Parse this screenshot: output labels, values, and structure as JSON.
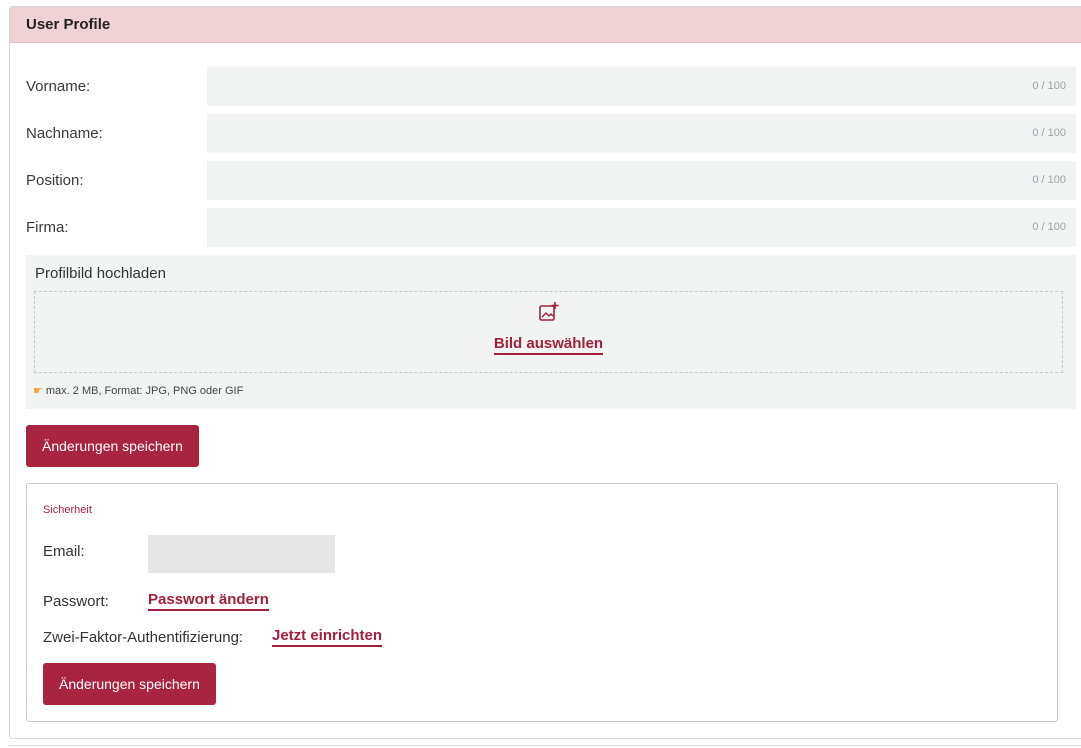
{
  "panel": {
    "title": "User Profile"
  },
  "fields": [
    {
      "label": "Vorname:",
      "value": "",
      "counter": "0 / 100"
    },
    {
      "label": "Nachname:",
      "value": "",
      "counter": "0 / 100"
    },
    {
      "label": "Position:",
      "value": "",
      "counter": "0 / 100"
    },
    {
      "label": "Firma:",
      "value": "",
      "counter": "0 / 100"
    }
  ],
  "upload": {
    "title": "Profilbild hochladen",
    "link_label": "Bild auswählen",
    "hint": "max. 2 MB, Format: JPG, PNG oder GIF",
    "icon": "add-image-icon",
    "hint_icon": "pointing-hand-icon"
  },
  "save_button_label": "Änderungen speichern",
  "security": {
    "title": "Sicherheit",
    "email_label": "Email:",
    "email_value": "",
    "password_label": "Passwort:",
    "password_link": "Passwort ändern",
    "twofa_label": "Zwei-Faktor-Authentifizierung:",
    "twofa_link": "Jetzt einrichten",
    "save_button_label": "Änderungen speichern"
  },
  "colors": {
    "header_bg": "#eed2d6",
    "accent": "#a92440",
    "input_bg": "#f2f4f4"
  }
}
